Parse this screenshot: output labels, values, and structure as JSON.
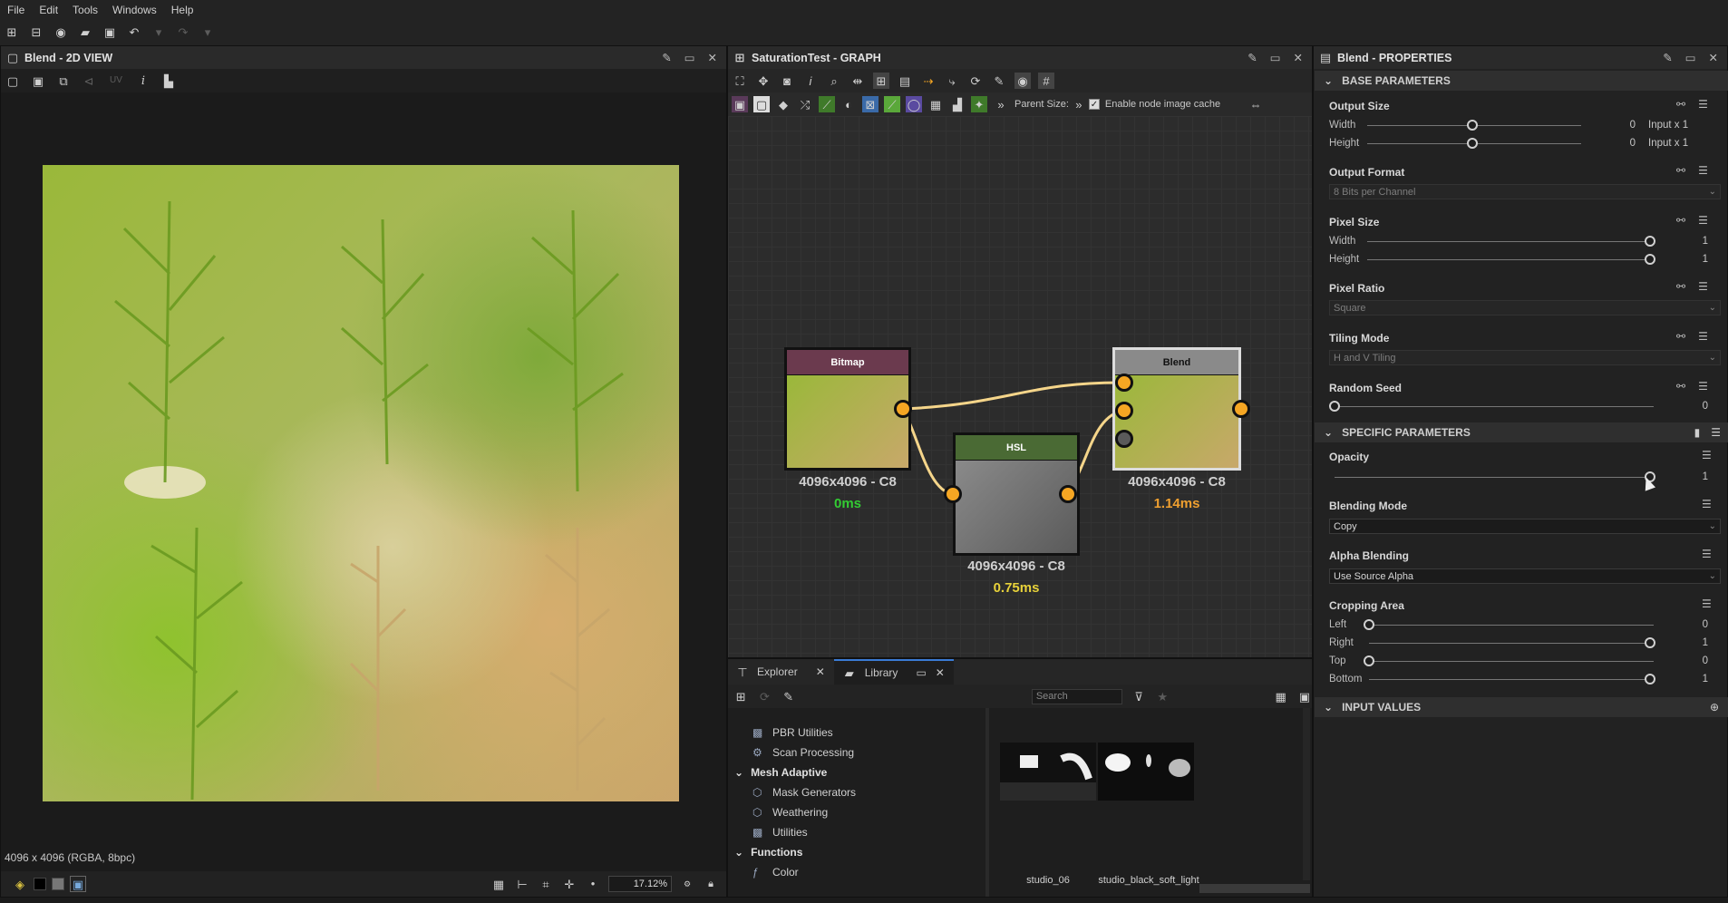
{
  "menu": [
    "File",
    "Edit",
    "Tools",
    "Windows",
    "Help"
  ],
  "view2d": {
    "title": "Blend - 2D VIEW",
    "uv_label": "UV",
    "status": "4096 x 4096 (RGBA, 8bpc)",
    "zoom": "17.12%"
  },
  "graph": {
    "title": "SaturationTest - GRAPH",
    "parent_size_label": "Parent Size:",
    "cache_label": "Enable node image cache",
    "nodes": {
      "bitmap": {
        "title": "Bitmap",
        "size": "4096x4096 - C8",
        "time": "0ms",
        "head_color": "#6b3a4e"
      },
      "hsl": {
        "title": "HSL",
        "size": "4096x4096 - C8",
        "time": "0.75ms",
        "head_color": "#4a6a34"
      },
      "blend": {
        "title": "Blend",
        "size": "4096x4096 - C8",
        "time": "1.14ms",
        "head_color": "#8a8a8a"
      }
    }
  },
  "library": {
    "tab_explorer": "Explorer",
    "tab_library": "Library",
    "search_placeholder": "Search",
    "tree": [
      {
        "label": "PBR Utilities",
        "type": "item"
      },
      {
        "label": "Scan Processing",
        "type": "item"
      },
      {
        "label": "Mesh Adaptive",
        "type": "group"
      },
      {
        "label": "Mask Generators",
        "type": "item"
      },
      {
        "label": "Weathering",
        "type": "item"
      },
      {
        "label": "Utilities",
        "type": "item"
      },
      {
        "label": "Functions",
        "type": "group"
      },
      {
        "label": "Color",
        "type": "item"
      }
    ],
    "thumbs": [
      "studio_06",
      "studio_black_soft_light"
    ]
  },
  "props": {
    "title": "Blend - PROPERTIES",
    "base_section": "BASE PARAMETERS",
    "specific_section": "SPECIFIC PARAMETERS",
    "input_section": "INPUT VALUES",
    "output_size": {
      "label": "Output Size",
      "width_label": "Width",
      "height_label": "Height",
      "width_value": "0",
      "height_value": "0",
      "width_mode": "Input x 1",
      "height_mode": "Input x 1"
    },
    "output_format": {
      "label": "Output Format",
      "value": "8 Bits per Channel"
    },
    "pixel_size": {
      "label": "Pixel Size",
      "width_label": "Width",
      "height_label": "Height",
      "width_value": "1",
      "height_value": "1"
    },
    "pixel_ratio": {
      "label": "Pixel Ratio",
      "value": "Square"
    },
    "tiling_mode": {
      "label": "Tiling Mode",
      "value": "H and V Tiling"
    },
    "random_seed": {
      "label": "Random Seed",
      "value": "0"
    },
    "opacity": {
      "label": "Opacity",
      "value": "1"
    },
    "blending_mode": {
      "label": "Blending Mode",
      "value": "Copy"
    },
    "alpha_blending": {
      "label": "Alpha Blending",
      "value": "Use Source Alpha"
    },
    "cropping": {
      "label": "Cropping Area",
      "left_label": "Left",
      "right_label": "Right",
      "top_label": "Top",
      "bottom_label": "Bottom",
      "left": "0",
      "right": "1",
      "top": "0",
      "bottom": "1"
    }
  },
  "colors": {
    "port": "#f5a623",
    "accent_time_green": "#33cc33",
    "accent_time_yellow": "#e8d23a",
    "accent_time_orange": "#f0a030"
  }
}
